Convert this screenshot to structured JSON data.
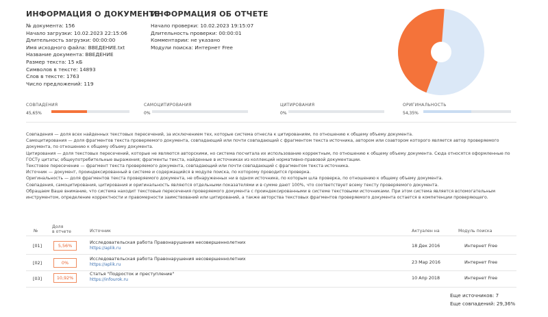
{
  "document_info": {
    "title": "ИНФОРМАЦИЯ О ДОКУМЕНТЕ",
    "lines": [
      "№ документа: 156",
      "Начало загрузки: 10.02.2023 22:15:06",
      "Длительность загрузки: 00:00:00",
      "Имя исходного файла: ВВЕДЕНИЕ.txt",
      "Название документа: ВВЕДЕНИЕ",
      "Размер текста: 15 кБ",
      "Символов в тексте: 14893",
      "Слов в тексте: 1763",
      "Число предложений: 119"
    ]
  },
  "report_info": {
    "title": "ИНФОРМАЦИЯ ОБ ОТЧЕТЕ",
    "lines": [
      "Начало проверки: 10.02.2023 19:15:07",
      "Длительность проверки: 00:00:01",
      "Комментарии: не указано",
      "Модули поиска: Интернет Free"
    ]
  },
  "pie": {
    "match_share": 45.65,
    "colors": {
      "match": "#f4733a",
      "original": "#dbe8f7"
    }
  },
  "metrics": [
    {
      "label": "СОВПАДЕНИЯ",
      "value": "45,65%",
      "fraction": 0.4565,
      "color": "#f4733a"
    },
    {
      "label": "САМОЦИТИРОВАНИЯ",
      "value": "0%",
      "fraction": 0,
      "color": "#f4733a"
    },
    {
      "label": "ЦИТИРОВАНИЯ",
      "value": "0%",
      "fraction": 0,
      "color": "#f4733a"
    },
    {
      "label": "ОРИГИНАЛЬНОСТЬ",
      "value": "54,35%",
      "fraction": 0.5435,
      "color": "#c9dcf2"
    }
  ],
  "legend": [
    "Совпадения — доля всех найденных текстовых пересечений, за исключением тех, которые система отнесла к цитированиям, по отношению к общему объему документа.",
    "Самоцитирования — доля фрагментов текста проверяемого документа, совпадающий или почти совпадающий с фрагментом текста источника, автором или соавтором которого является автор проверяемого документа, по отношению к общему объему документа.",
    "Цитирования — доля текстовых пересечений, которые не являются авторскими, но система посчитала их использование корректным, по отношению к общему объему документа. Сюда относятся оформленные по ГОСТу цитаты; общеупотребительные выражения; фрагменты текста, найденные в источниках из коллекций нормативно-правовой документации.",
    "Текстовое пересечение — фрагмент текста проверяемого документа, совпадающий или почти совпадающий с фрагментом текста источника.",
    "Источник — документ, проиндексированный в системе и содержащийся в модуле поиска, по которому проводится проверка.",
    "Оригинальность — доля фрагментов текста проверяемого документа, не обнаруженных ни в одном источнике, по которым шла проверка, по отношению к общему объему документа.",
    "Совпадения, самоцитирования, цитирования и оригинальность являются отдельными показателями и в сумме дают 100%, что соответствует всему тексту проверяемого документа.",
    "Обращаем Ваше внимание, что система находит текстовые пересечения проверяемого документа с проиндексированными в системе текстовыми источниками. При этом система является вспомогательным инструментом, определение корректности и правомерности заимствований или цитирований, а также авторства текстовых фрагментов проверяемого документа остается в компетенции проверяющего."
  ],
  "table": {
    "headers": {
      "num": "№",
      "share_line1": "Доля",
      "share_line2": "в отчете",
      "source": "Источник",
      "actual": "Актуален на",
      "module": "Модуль поиска"
    },
    "rows": [
      {
        "num": "[01]",
        "share": "5,56%",
        "title": "Исследовательская работа Правонарушения несовершеннолетних",
        "url": "https://aplik.ru",
        "date": "18 Дек 2016",
        "module": "Интернет Free"
      },
      {
        "num": "[02]",
        "share": "0%",
        "title": "Исследовательская работа Правонарушения несовершеннолетних",
        "url": "https://aplik.ru",
        "date": "23 Мар 2016",
        "module": "Интернет Free"
      },
      {
        "num": "[03]",
        "share": "10,92%",
        "title": "Статья \"Подросток и преступление\"",
        "url": "https://infourok.ru",
        "date": "10 Апр 2018",
        "module": "Интернет Free"
      }
    ]
  },
  "footer": {
    "more_sources": "Еще источников: 7",
    "more_matches": "Еще совпадений: 29,36%"
  }
}
